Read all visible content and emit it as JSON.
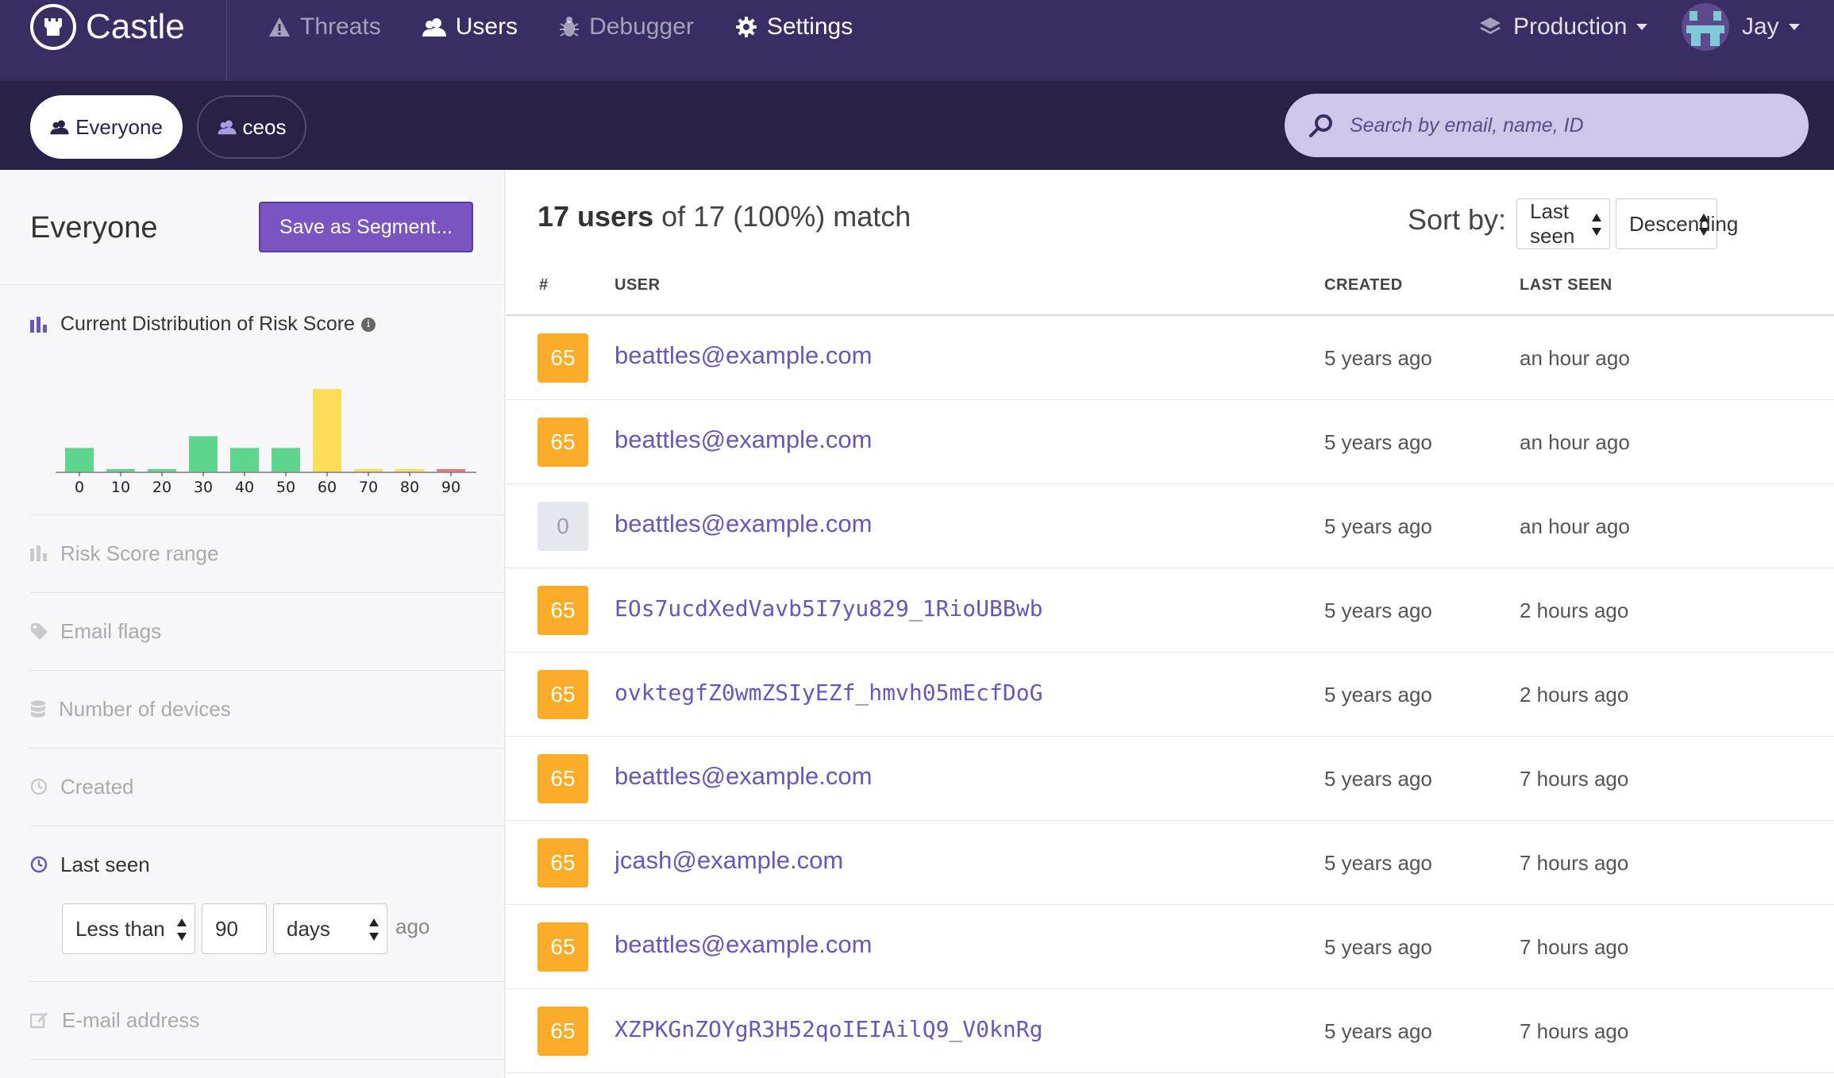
{
  "app": {
    "name": "Castle"
  },
  "colors": {
    "nav_bg": "#3a2d64",
    "seg_bg": "#292146",
    "accent": "#7a55c2",
    "link": "#6a55b8",
    "risk_high": "#f9ac28",
    "risk_none": "#e4e7ec"
  },
  "nav": {
    "items": [
      {
        "label": "Threats",
        "icon": "warning-icon"
      },
      {
        "label": "Users",
        "icon": "users-icon"
      },
      {
        "label": "Debugger",
        "icon": "bug-icon"
      },
      {
        "label": "Settings",
        "icon": "gear-icon"
      }
    ],
    "environment": "Production",
    "user_name": "Jay"
  },
  "segments": {
    "items": [
      {
        "label": "Everyone",
        "active": true
      },
      {
        "label": "ceos",
        "active": false
      }
    ],
    "search_placeholder": "Search by email, name, ID"
  },
  "sidebar": {
    "title": "Everyone",
    "save_label": "Save as Segment...",
    "distribution_title": "Current Distribution of Risk Score",
    "filters": {
      "risk_range": "Risk Score range",
      "email_flags": "Email flags",
      "devices": "Number of devices",
      "created": "Created",
      "last_seen": "Last seen",
      "email": "E-mail address"
    },
    "last_seen_filter": {
      "operator": "Less than",
      "value": "90",
      "unit": "days",
      "suffix": "ago"
    }
  },
  "chart_data": {
    "type": "bar",
    "categories": [
      "0",
      "10",
      "20",
      "30",
      "40",
      "50",
      "60",
      "70",
      "80",
      "90"
    ],
    "values": [
      2,
      0,
      0,
      3,
      2,
      2,
      7,
      0,
      0,
      0
    ],
    "colors": [
      "#5ed58c",
      "#5ed58c",
      "#5ed58c",
      "#5ed58c",
      "#5ed58c",
      "#5ed58c",
      "#fddc58",
      "#fddc58",
      "#fddc58",
      "#f2707c"
    ],
    "title": "Current Distribution of Risk Score",
    "xlabel": "",
    "ylabel": ""
  },
  "main": {
    "count_bold": "17 users",
    "count_rest": "of 17 (100%) match",
    "sort_label": "Sort by:",
    "sort_field": "Last seen",
    "sort_order": "Descending",
    "headers": {
      "num": "#",
      "user": "USER",
      "created": "CREATED",
      "last_seen": "LAST SEEN"
    },
    "rows": [
      {
        "risk": "65",
        "user": "beattles@example.com",
        "created": "5 years ago",
        "last_seen": "an hour ago"
      },
      {
        "risk": "65",
        "user": "beattles@example.com",
        "created": "5 years ago",
        "last_seen": "an hour ago"
      },
      {
        "risk": "0",
        "user": "beattles@example.com",
        "created": "5 years ago",
        "last_seen": "an hour ago"
      },
      {
        "risk": "65",
        "user": "EOs7ucdXedVavb5I7yu829_1RioUBBwb",
        "created": "5 years ago",
        "last_seen": "2 hours ago"
      },
      {
        "risk": "65",
        "user": "ovktegfZ0wmZSIyEZf_hmvh05mEcfDoG",
        "created": "5 years ago",
        "last_seen": "2 hours ago"
      },
      {
        "risk": "65",
        "user": "beattles@example.com",
        "created": "5 years ago",
        "last_seen": "7 hours ago"
      },
      {
        "risk": "65",
        "user": "jcash@example.com",
        "created": "5 years ago",
        "last_seen": "7 hours ago"
      },
      {
        "risk": "65",
        "user": "beattles@example.com",
        "created": "5 years ago",
        "last_seen": "7 hours ago"
      },
      {
        "risk": "65",
        "user": "XZPKGnZOYgR3H52qoIEIAilQ9_V0knRg",
        "created": "5 years ago",
        "last_seen": "7 hours ago"
      }
    ]
  }
}
